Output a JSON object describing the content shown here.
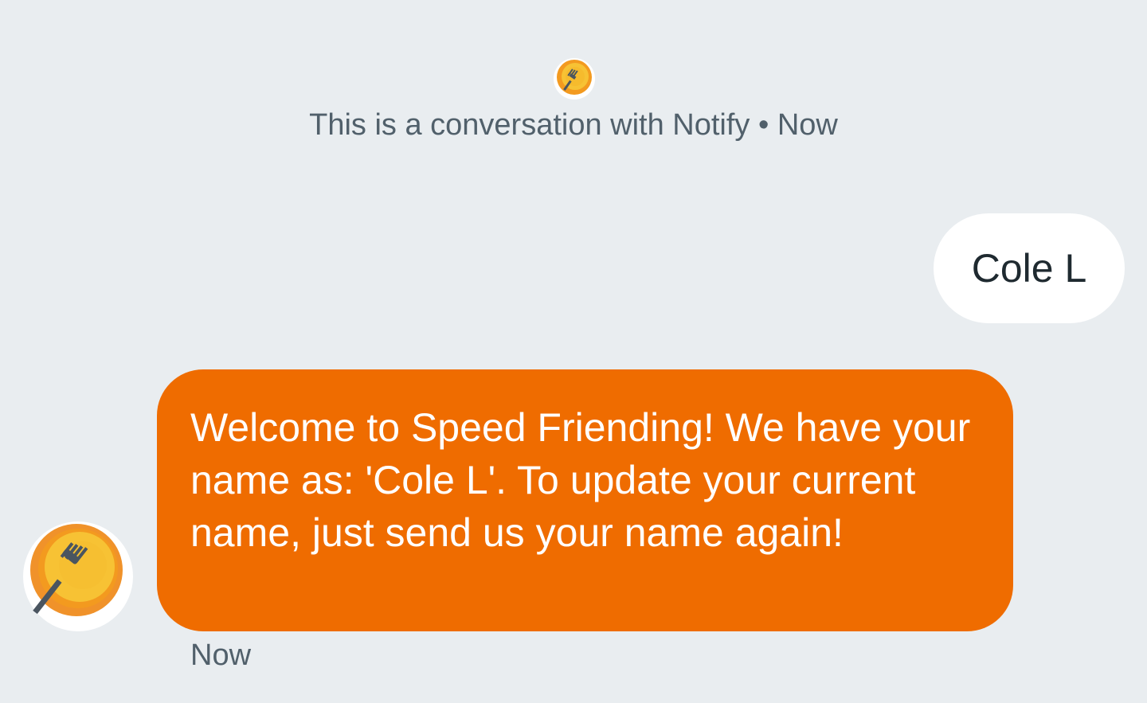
{
  "header": {
    "avatar_icon": "fork-plate-logo-icon",
    "text": "This is a conversation with Notify • Now"
  },
  "messages": [
    {
      "direction": "sent",
      "text": "Cole L"
    },
    {
      "direction": "received",
      "text": "Welcome to Speed Friending! We have your name as: 'Cole L'. To update your current name, just send us your name again!",
      "avatar_icon": "fork-plate-logo-icon",
      "timestamp": "Now"
    }
  ],
  "colors": {
    "background": "#e9edf0",
    "sent_bubble": "#ffffff",
    "received_bubble": "#ef6c00",
    "meta_text": "#51606b"
  }
}
